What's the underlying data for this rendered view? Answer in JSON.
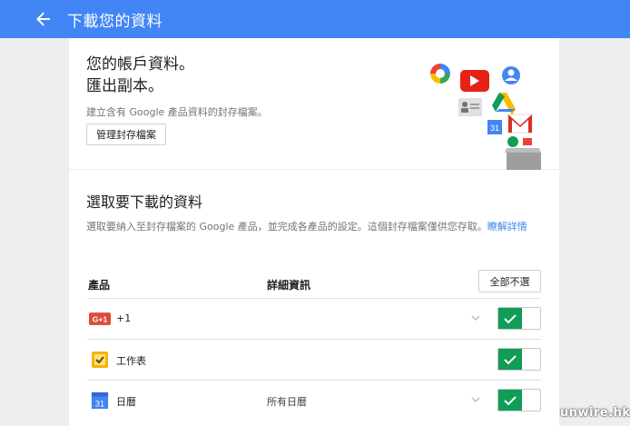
{
  "header": {
    "title": "下載您的資料",
    "back_icon": "arrow-left-icon"
  },
  "hero": {
    "title_line1": "您的帳戶資料。",
    "title_line2": "匯出副本。",
    "description": "建立含有 Google 產品資料的封存檔案。",
    "manage_button": "管理封存檔案"
  },
  "select": {
    "title": "選取要下載的資料",
    "description": "選取要納入至封存檔案的 Google 產品，並完成各產品的設定。這個封存檔案僅供您存取。",
    "learn_more": "瞭解詳情",
    "col_product": "產品",
    "col_details": "詳細資訊",
    "deselect_all": "全部不選"
  },
  "products": [
    {
      "name": "+1",
      "icon": "google-plus-one-icon",
      "details": "",
      "enabled": true
    },
    {
      "name": "工作表",
      "icon": "google-keep-tasks-icon",
      "details": "",
      "enabled": true
    },
    {
      "name": "日曆",
      "icon": "google-calendar-icon",
      "details": "所有日曆",
      "enabled": true
    }
  ],
  "watermark": "unwire.hk",
  "colors": {
    "brand_blue": "#4285f4",
    "toggle_green": "#0f9d58",
    "background": "#eeeeee"
  }
}
